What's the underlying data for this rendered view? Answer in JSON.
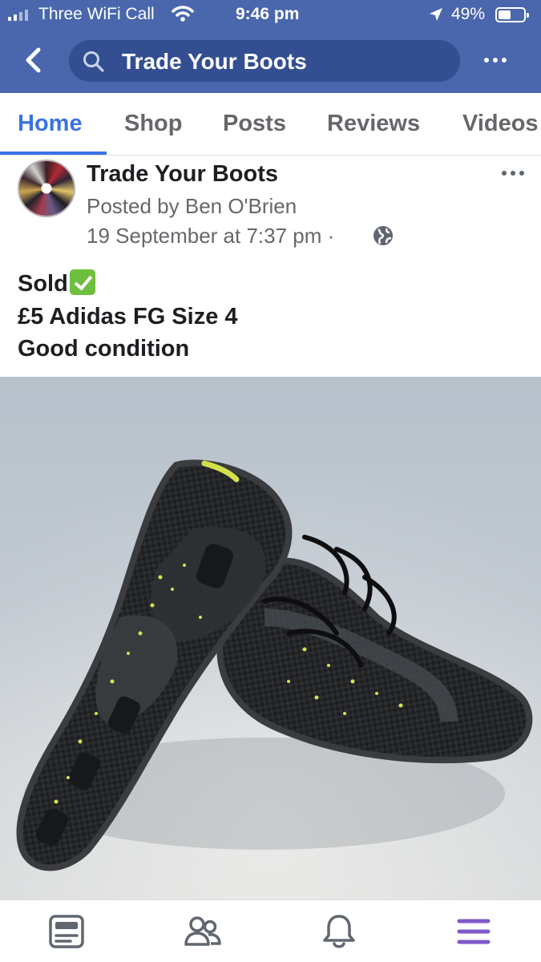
{
  "status_bar": {
    "carrier": "Three WiFi Call",
    "time": "9:46 pm",
    "battery_percent": "49%",
    "battery_level": 0.49,
    "icons": [
      "signal-bars-icon",
      "wifi-icon",
      "location-arrow-icon",
      "battery-icon"
    ]
  },
  "header": {
    "back_icon": "chevron-left-icon",
    "search_icon": "search-icon",
    "search_text": "Trade Your Boots",
    "more_icon": "more-horizontal-icon",
    "color": "#4a67ad"
  },
  "tabs": [
    {
      "label": "Home",
      "active": true
    },
    {
      "label": "Shop",
      "active": false
    },
    {
      "label": "Posts",
      "active": false
    },
    {
      "label": "Reviews",
      "active": false
    },
    {
      "label": "Videos",
      "active": false
    }
  ],
  "post": {
    "page_name": "Trade Your Boots",
    "posted_by": "Posted by Ben O'Brien",
    "timestamp": "19 September at 7:37 pm ·",
    "privacy_icon": "globe-icon",
    "lines": [
      "Sold",
      "£5 Adidas FG Size 4",
      "Good condition"
    ],
    "sold_emoji": "white-check-mark-emoji"
  },
  "bottom_nav": [
    {
      "name": "news-feed-icon",
      "active": false
    },
    {
      "name": "friends-icon",
      "active": false
    },
    {
      "name": "notifications-bell-icon",
      "active": false
    },
    {
      "name": "menu-icon",
      "active": true
    }
  ],
  "colors": {
    "accent": "#3b73e4",
    "menu_active": "#7e5ac8",
    "secondary_text": "#65676b"
  }
}
